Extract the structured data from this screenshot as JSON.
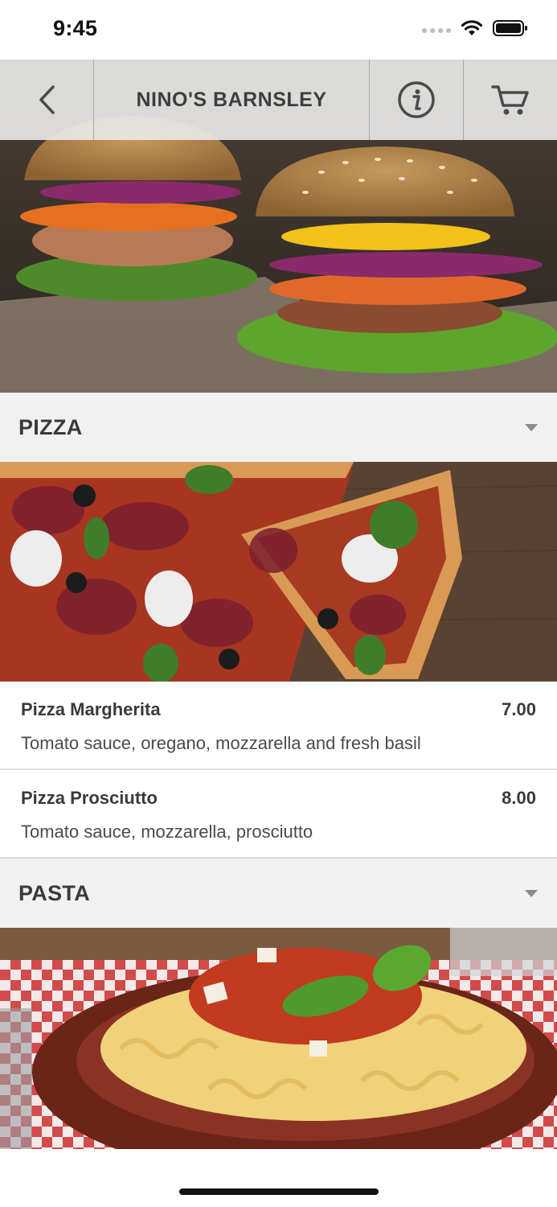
{
  "status_bar": {
    "time": "9:45",
    "icons": [
      "signal-dots-icon",
      "wifi-icon",
      "battery-icon"
    ]
  },
  "nav": {
    "title": "NINO'S BARNSLEY",
    "icons": [
      "back-chevron-icon",
      "info-icon",
      "cart-icon"
    ]
  },
  "hero": {
    "image": "burgers-photo"
  },
  "categories": [
    {
      "label": "PIZZA",
      "image": "pizza-photo",
      "items": [
        {
          "name": "Pizza Margherita",
          "price": "7.00",
          "description": "Tomato sauce, oregano, mozzarella and fresh basil"
        },
        {
          "name": "Pizza Prosciutto",
          "price": "8.00",
          "description": "Tomato sauce, mozzarella, prosciutto"
        }
      ]
    },
    {
      "label": "PASTA",
      "image": "pasta-photo",
      "items": []
    }
  ],
  "colors": {
    "category_bg": "#f1f1f1",
    "nav_bg": "#e8e8e6",
    "text": "#3a3a3a",
    "divider": "#dcdcdc"
  }
}
